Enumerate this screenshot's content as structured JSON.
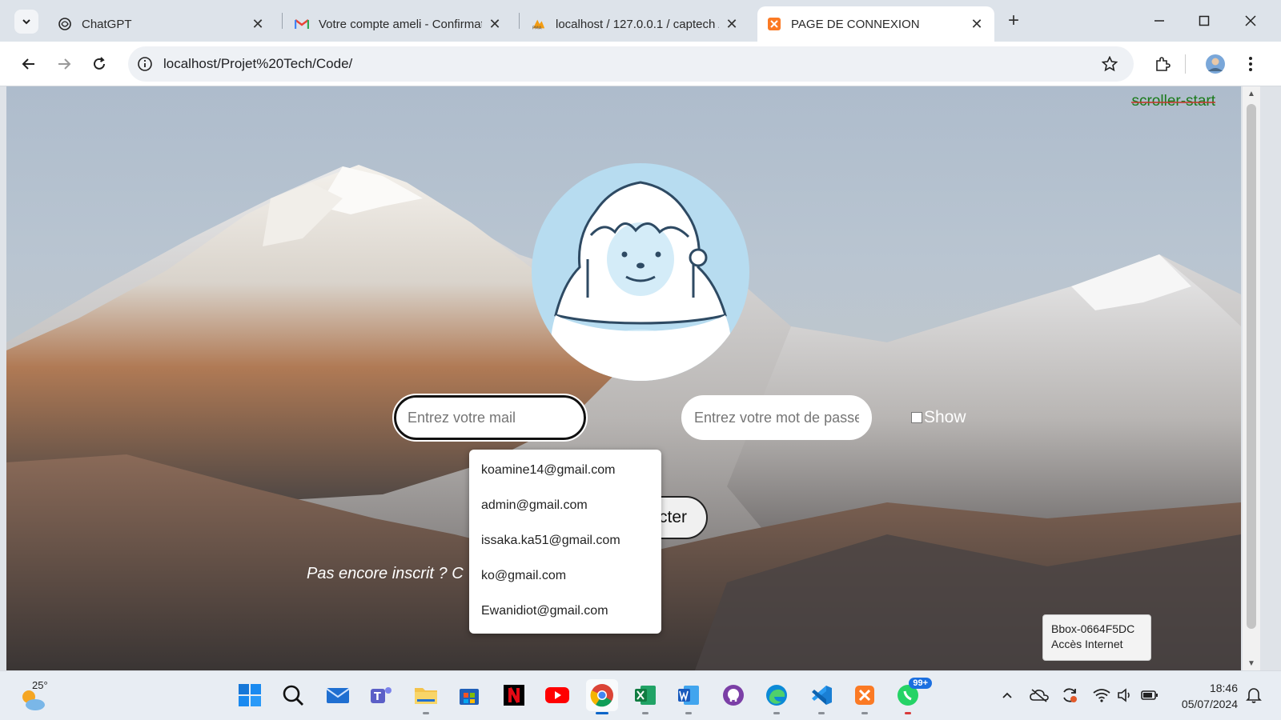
{
  "browser": {
    "tabs": [
      {
        "title": "ChatGPT",
        "icon": "chatgpt-icon"
      },
      {
        "title": "Votre compte ameli - Confirmat",
        "icon": "gmail-icon"
      },
      {
        "title": "localhost / 127.0.0.1 / captech /",
        "icon": "phpmyadmin-icon"
      },
      {
        "title": "PAGE DE CONNEXION",
        "icon": "xampp-icon",
        "active": true
      }
    ],
    "url": "localhost/Projet%20Tech/Code/"
  },
  "page": {
    "scroller_label": "scroller-start",
    "mail_placeholder": "Entrez votre mail",
    "password_placeholder": "Entrez votre mot de passe",
    "show_label": "Show",
    "login_button_visible_text": "cter",
    "signup_visible_text": "Pas encore inscrit ? C",
    "autocomplete_options": [
      "koamine14@gmail.com",
      "admin@gmail.com",
      "issaka.ka51@gmail.com",
      "ko@gmail.com",
      "Ewanidiot@gmail.com"
    ]
  },
  "network_tooltip": {
    "line1": "Bbox-0664F5DC",
    "line2": "Accès Internet"
  },
  "taskbar": {
    "weather_temp": "25°",
    "whatsapp_badge": "99+",
    "time": "18:46",
    "date": "05/07/2024"
  }
}
